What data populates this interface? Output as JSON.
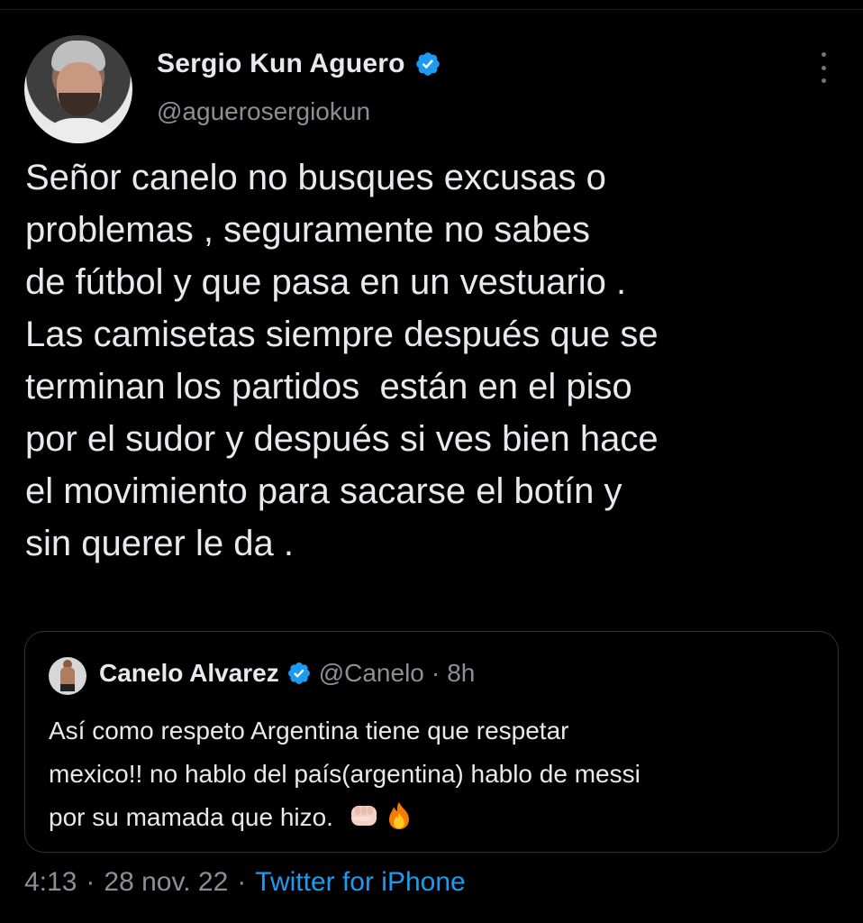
{
  "author": {
    "display_name": "Sergio Kun Aguero",
    "handle": "@aguerosergiokun",
    "verified_icon": "verified-badge-icon",
    "verified_color": "#1d9bf0"
  },
  "tweet": {
    "text": "Señor canelo no busques excusas o\nproblemas , seguramente no sabes\nde fútbol y que pasa en un vestuario .\nLas camisetas siempre después que se\nterminan los partidos  están en el piso\npor el sudor y después si ves bien hace\nel movimiento para sacarse el botín y\nsin querer le da ."
  },
  "quote": {
    "display_name": "Canelo Alvarez",
    "handle": "@Canelo",
    "separator": "·",
    "time": "8h",
    "text": "Así como respeto Argentina tiene que respetar\nmexico!! no hablo del país(argentina) hablo de messi\npor su mamada que hizo.",
    "emojis": [
      "fist-icon",
      "fire-icon"
    ]
  },
  "meta": {
    "time": "4:13",
    "separator_1": "·",
    "date": "28 nov. 22",
    "separator_2": "·",
    "source": "Twitter for iPhone"
  },
  "colors": {
    "background": "#000000",
    "text_primary": "#e7e9ea",
    "text_secondary": "#8b9096",
    "link": "#1d9bf0",
    "border": "#2f3336"
  }
}
